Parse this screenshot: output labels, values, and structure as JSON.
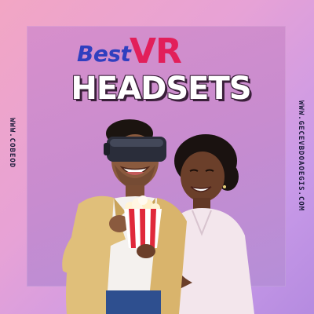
{
  "poster": {
    "title_best": "Best",
    "title_vr": "VR",
    "title_headsets": "HEADSETS",
    "side_left": "WWW.COBEOD",
    "side_right": "WWW.GECEVBDOAOEGIS.COM"
  },
  "colors": {
    "accent_blue": "#2f3fbf",
    "accent_red": "#e21f5a",
    "background_pink": "#f2a6c4",
    "background_purple": "#b58be0"
  },
  "illustration": {
    "people": [
      "man-wearing-vr-headset",
      "smiling-woman"
    ],
    "props": [
      "vr-headset",
      "popcorn-bucket"
    ]
  }
}
